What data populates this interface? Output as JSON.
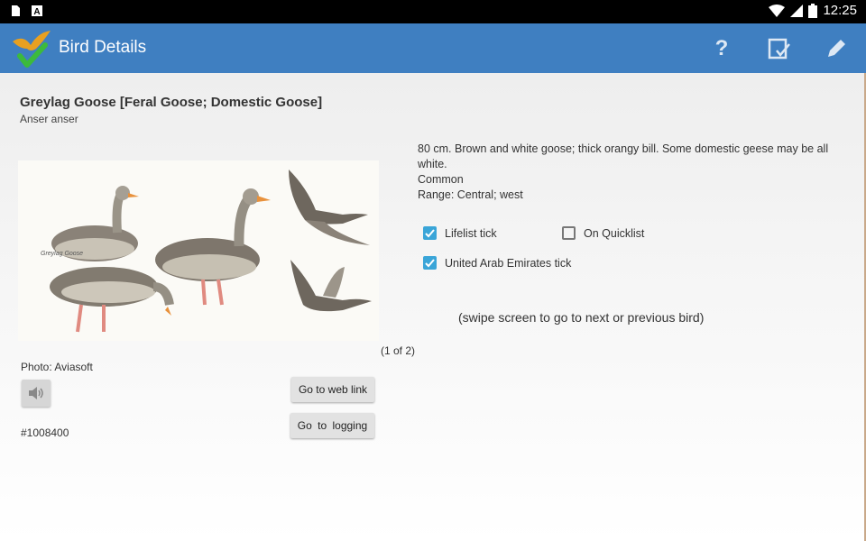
{
  "status_bar": {
    "time": "12:25"
  },
  "app_bar": {
    "title": "Bird Details"
  },
  "bird": {
    "common_name": "Greylag Goose [Feral Goose; Domestic Goose]",
    "scientific_name": "Anser anser",
    "image_caption": "Greylag Goose",
    "page_counter": "(1 of 2)",
    "photo_credit": "Photo:  Aviasoft",
    "id": "#1008400",
    "description": "80 cm. Brown and white goose; thick orangy bill. Some domestic geese may be all white.",
    "status": "Common",
    "range": "Range: Central; west"
  },
  "checkboxes": {
    "lifelist": {
      "label": "Lifelist tick",
      "checked": true
    },
    "quicklist": {
      "label": "On Quicklist",
      "checked": false
    },
    "country": {
      "label": "United Arab Emirates tick",
      "checked": true
    }
  },
  "buttons": {
    "web_link": "Go to web link",
    "logging": "Go to logging"
  },
  "hint": "(swipe screen to go to next or previous bird)",
  "colors": {
    "app_bar": "#3f7fc1",
    "checkbox": "#3aa5d8",
    "status_bar": "#000000"
  },
  "icons": [
    "sd-card-icon",
    "notification-a-icon",
    "wifi-icon",
    "signal-icon",
    "battery-icon",
    "bird-logo-icon",
    "help-icon",
    "checklist-icon",
    "edit-pencil-icon",
    "speaker-icon"
  ]
}
